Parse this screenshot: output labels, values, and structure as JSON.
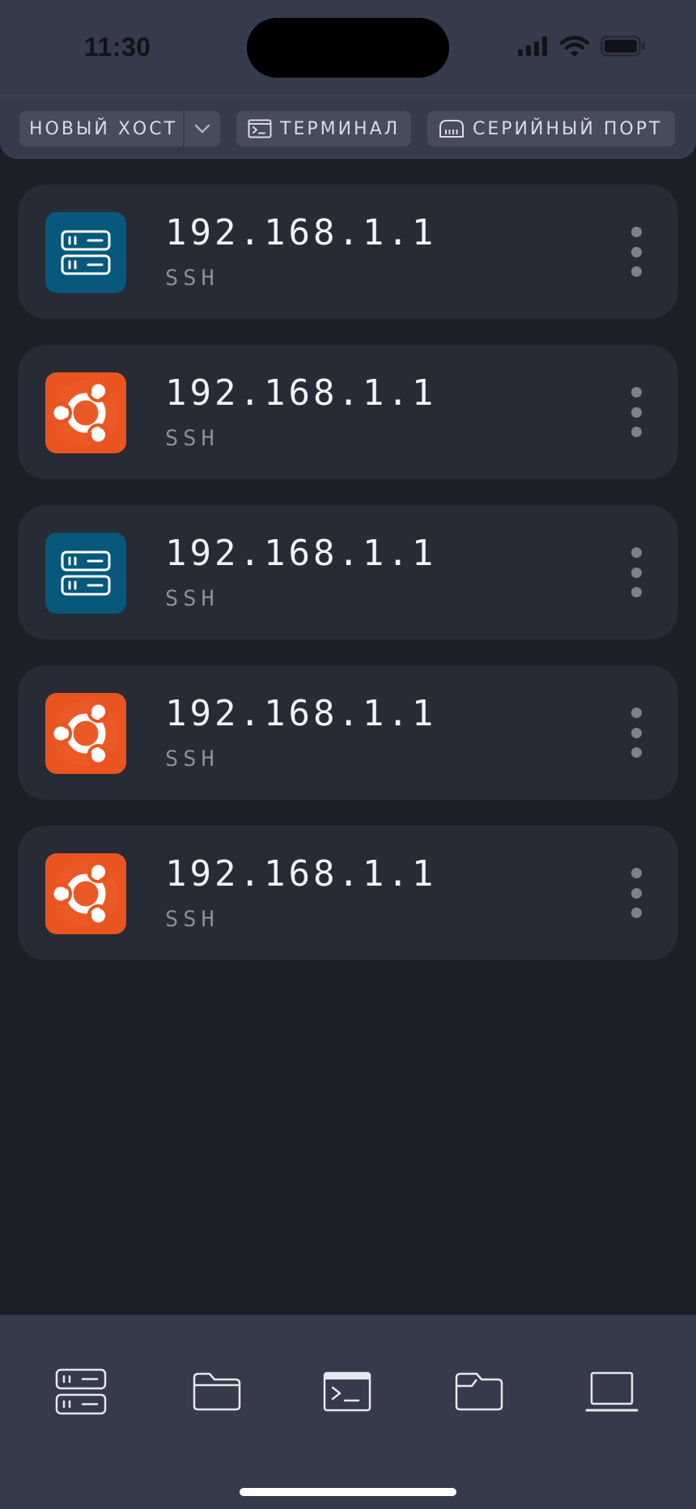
{
  "status_bar": {
    "time": "11:30"
  },
  "toolbar": {
    "new_host": "НОВЫЙ ХОСТ",
    "terminal": "ТЕРМИНАЛ",
    "serial_port": "СЕРИЙНЫЙ ПОРТ"
  },
  "hosts": [
    {
      "address": "192.168.1.1",
      "protocol": "SSH",
      "icon": "server-icon"
    },
    {
      "address": "192.168.1.1",
      "protocol": "SSH",
      "icon": "ubuntu-icon"
    },
    {
      "address": "192.168.1.1",
      "protocol": "SSH",
      "icon": "server-icon"
    },
    {
      "address": "192.168.1.1",
      "protocol": "SSH",
      "icon": "ubuntu-icon"
    },
    {
      "address": "192.168.1.1",
      "protocol": "SSH",
      "icon": "ubuntu-icon"
    }
  ],
  "tab_bar": {
    "tabs": [
      "hosts-tab-icon",
      "folder-tab-icon",
      "terminal-tab-icon",
      "files-tab-icon",
      "laptop-tab-icon"
    ]
  },
  "colors": {
    "background": "#1c1f27",
    "card": "#272b36",
    "bars": "#353b4a",
    "server_icon_bg": "#07587a",
    "ubuntu_icon_bg": "#e95420"
  }
}
